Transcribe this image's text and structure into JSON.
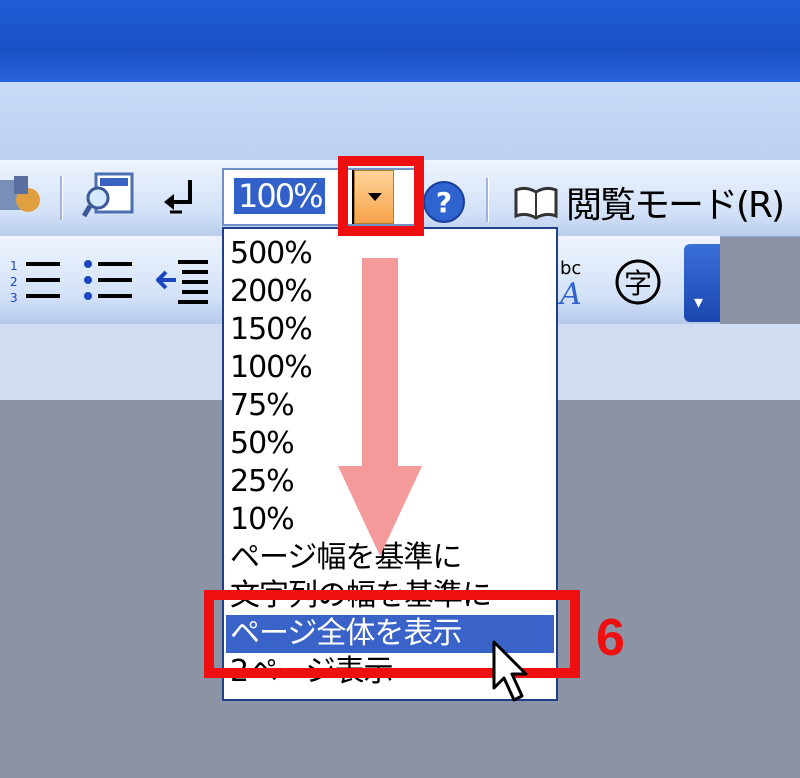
{
  "toolbar": {
    "zoom_value": "100%",
    "read_mode_label": "閲覧モード(R)",
    "encircle_glyph": "字"
  },
  "zoom_menu": {
    "options": [
      "500%",
      "200%",
      "150%",
      "100%",
      "75%",
      "50%",
      "25%",
      "10%",
      "ページ幅を基準に",
      "文字列の幅を基準に",
      "ページ全体を表示",
      "2ページ表示"
    ],
    "selected_index": 10
  },
  "annotation": {
    "step_number": "6",
    "highlight_color": "#ee1010",
    "arrow_color": "#f59a9a"
  },
  "colors": {
    "selection": "#3a63c9",
    "titlebar": "#1f5fd6",
    "workspace": "#8c93a4"
  }
}
